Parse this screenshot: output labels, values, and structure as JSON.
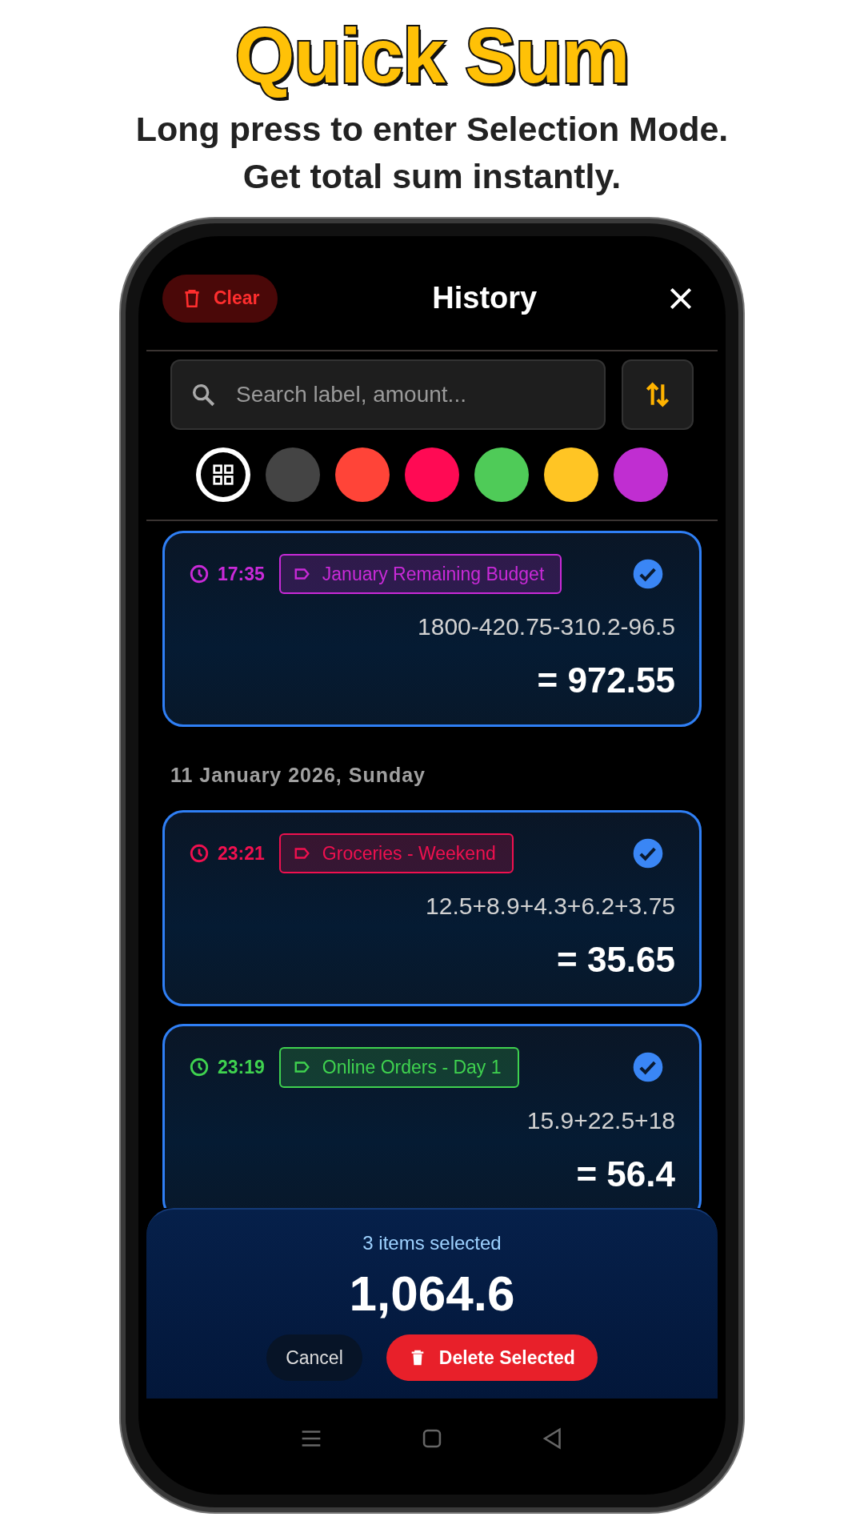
{
  "header": {
    "title": "Quick Sum",
    "subtitle": [
      "Long press to enter Selection Mode.",
      "Get total sum instantly."
    ]
  },
  "app": {
    "clear_button": "Clear",
    "title": "History",
    "search": {
      "placeholder": "Search label, amount..."
    },
    "color_filters": [
      {
        "kind": "all",
        "selected": true
      },
      {
        "kind": "color",
        "color": "#444444",
        "selected": false
      },
      {
        "kind": "color",
        "color": "#ff4438",
        "selected": false
      },
      {
        "kind": "color",
        "color": "#ff0a54",
        "selected": false
      },
      {
        "kind": "color",
        "color": "#4fcb58",
        "selected": false
      },
      {
        "kind": "color",
        "color": "#ffc524",
        "selected": false
      },
      {
        "kind": "color",
        "color": "#c02ed1",
        "selected": false
      }
    ],
    "history": [
      {
        "kind": "entry",
        "time": "17:35",
        "label": "January Remaining Budget",
        "expression": "1800-420.75-310.2-96.5",
        "result": "= 972.55",
        "color": "#c92ad8",
        "selected": true
      },
      {
        "kind": "date",
        "text": "11 January 2026, Sunday"
      },
      {
        "kind": "entry",
        "time": "23:21",
        "label": "Groceries - Weekend",
        "expression": "12.5+8.9+4.3+6.2+3.75",
        "result": "= 35.65",
        "color": "#f0104f",
        "selected": true
      },
      {
        "kind": "entry",
        "time": "23:19",
        "label": "Online Orders - Day 1",
        "expression": "15.9+22.5+18",
        "result": "= 56.4",
        "color": "#3fd24f",
        "selected": true
      }
    ],
    "selection_panel": {
      "count": "3 items selected",
      "total": "1,064.6",
      "cancel_button": "Cancel",
      "delete_button": "Delete Selected"
    }
  }
}
